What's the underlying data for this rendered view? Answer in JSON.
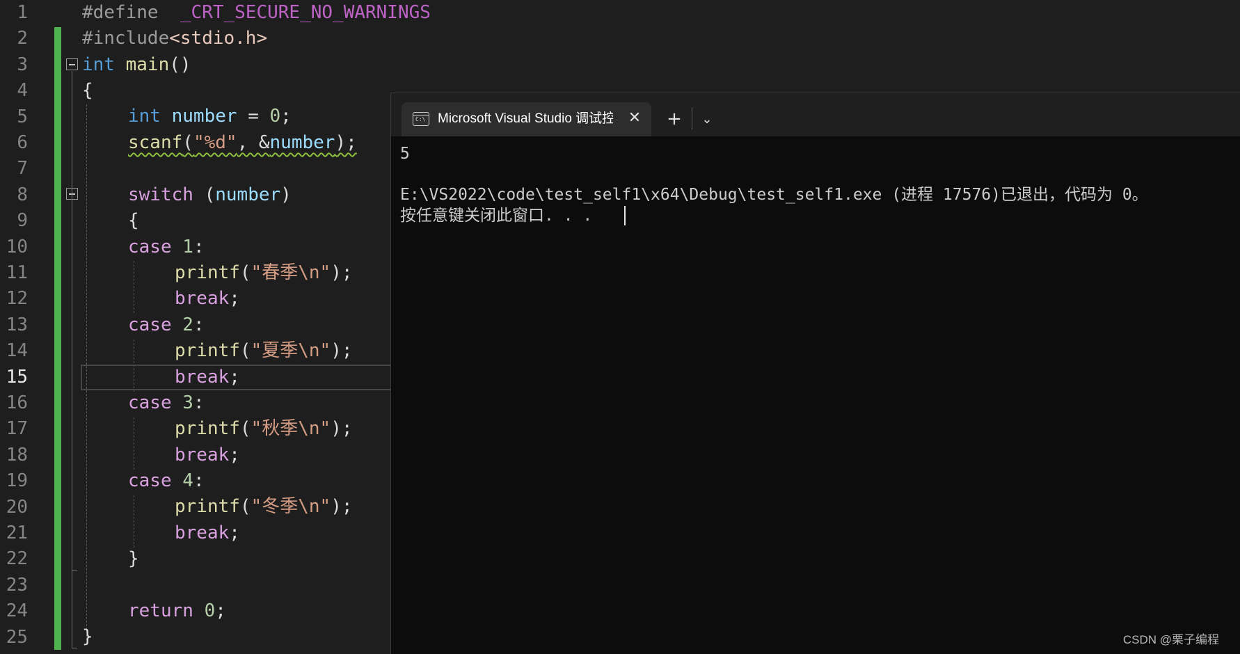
{
  "editor": {
    "line_numbers": [
      "1",
      "2",
      "3",
      "4",
      "5",
      "6",
      "7",
      "8",
      "9",
      "10",
      "11",
      "12",
      "13",
      "14",
      "15",
      "16",
      "17",
      "18",
      "19",
      "20",
      "21",
      "22",
      "23",
      "24",
      "25"
    ],
    "current_line": "15",
    "lines": {
      "l1": {
        "directive": "#define",
        "macro": "_CRT_SECURE_NO_WARNINGS"
      },
      "l2": {
        "directive": "#include",
        "header": "<stdio.h>"
      },
      "l3": {
        "type": "int",
        "name": "main",
        "parens": "()"
      },
      "l4": {
        "brace": "{"
      },
      "l5": {
        "type": "int",
        "var": "number",
        "op": " = ",
        "value": "0",
        "semi": ";"
      },
      "l6": {
        "fn": "scanf",
        "open": "(",
        "fmt": "\"%d\"",
        "comma": ", &",
        "var": "number",
        "close": ");"
      },
      "l8": {
        "kw": "switch",
        "open": " (",
        "var": "number",
        "close": ")"
      },
      "l9": {
        "brace": "{"
      },
      "l10": {
        "kw": "case",
        "value": " 1",
        "colon": ":"
      },
      "l11": {
        "fn": "printf",
        "open": "(",
        "str": "\"春季\\n\"",
        "close": ");"
      },
      "l12": {
        "kw": "break",
        "semi": ";"
      },
      "l13": {
        "kw": "case",
        "value": " 2",
        "colon": ":"
      },
      "l14": {
        "fn": "printf",
        "open": "(",
        "str": "\"夏季\\n\"",
        "close": ");"
      },
      "l15": {
        "kw": "break",
        "semi": ";"
      },
      "l16": {
        "kw": "case",
        "value": " 3",
        "colon": ":"
      },
      "l17": {
        "fn": "printf",
        "open": "(",
        "str": "\"秋季\\n\"",
        "close": ");"
      },
      "l18": {
        "kw": "break",
        "semi": ";"
      },
      "l19": {
        "kw": "case",
        "value": " 4",
        "colon": ":"
      },
      "l20": {
        "fn": "printf",
        "open": "(",
        "str": "\"冬季\\n\"",
        "close": ");"
      },
      "l21": {
        "kw": "break",
        "semi": ";"
      },
      "l22": {
        "brace": "}"
      },
      "l24": {
        "kw": "return",
        "value": " 0",
        "semi": ";"
      },
      "l25": {
        "brace": "}"
      }
    }
  },
  "console": {
    "tab_title": "Microsoft Visual Studio 调试控制台",
    "tab_icon_text": "C:\\",
    "close_glyph": "✕",
    "new_tab_glyph": "+",
    "dropdown_glyph": "⌄",
    "output": [
      "5",
      "",
      "E:\\VS2022\\code\\test_self1\\x64\\Debug\\test_self1.exe (进程 17576)已退出，代码为 0。",
      "按任意键关闭此窗口. . ."
    ]
  },
  "watermark": "CSDN @栗子编程",
  "colors": {
    "change_bar": "#4eb24e",
    "keyword": "#569cd6",
    "control": "#d8a0df",
    "function": "#dcdcaa",
    "variable": "#9cdcfe",
    "string": "#d69d85",
    "number": "#b5cea8"
  },
  "icons": [
    "collapse-icon",
    "console-app-icon",
    "close-icon",
    "plus-icon",
    "chevron-down-icon"
  ]
}
